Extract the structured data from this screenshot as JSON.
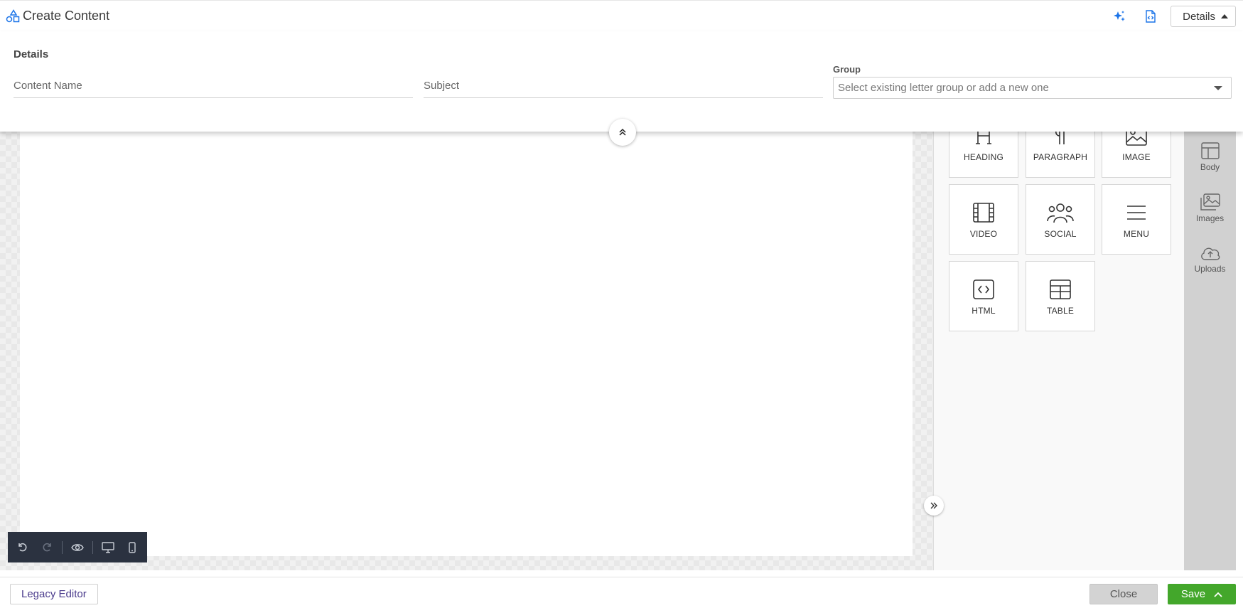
{
  "header": {
    "title": "Create Content",
    "details_button": "Details"
  },
  "details": {
    "heading": "Details",
    "content_name_placeholder": "Content Name",
    "subject_placeholder": "Subject",
    "group_label": "Group",
    "group_placeholder": "Select existing letter group or add a new one"
  },
  "blocks": [
    {
      "label": "HEADING",
      "icon": "heading-icon"
    },
    {
      "label": "PARAGRAPH",
      "icon": "paragraph-icon"
    },
    {
      "label": "IMAGE",
      "icon": "image-icon"
    },
    {
      "label": "VIDEO",
      "icon": "video-icon"
    },
    {
      "label": "SOCIAL",
      "icon": "social-icon"
    },
    {
      "label": "MENU",
      "icon": "menu-icon"
    },
    {
      "label": "HTML",
      "icon": "html-icon"
    },
    {
      "label": "TABLE",
      "icon": "table-icon"
    }
  ],
  "rail": [
    {
      "label": "Body",
      "icon": "body-layout-icon"
    },
    {
      "label": "Images",
      "icon": "images-icon"
    },
    {
      "label": "Uploads",
      "icon": "cloud-upload-icon"
    }
  ],
  "footer": {
    "legacy_label": "Legacy Editor",
    "close_label": "Close",
    "save_label": "Save"
  },
  "colors": {
    "accent_blue": "#1a73e8",
    "save_green": "#43a72b",
    "toolbar_dark": "#2b3240",
    "legacy_text": "#4a3b8c"
  }
}
